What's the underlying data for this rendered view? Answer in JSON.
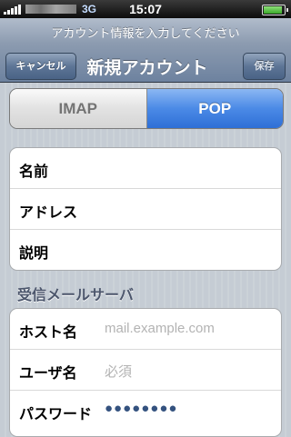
{
  "status_bar": {
    "network": "3G",
    "time": "15:07"
  },
  "navbar": {
    "prompt": "アカウント情報を入力してください",
    "cancel_label": "キャンセル",
    "title": "新規アカウント",
    "save_label": "保存"
  },
  "account_type": {
    "options": [
      "IMAP",
      "POP"
    ],
    "selected": "POP"
  },
  "account_fields": [
    {
      "label": "名前",
      "value": ""
    },
    {
      "label": "アドレス",
      "value": ""
    },
    {
      "label": "説明",
      "value": ""
    }
  ],
  "incoming_server": {
    "header": "受信メールサーバ",
    "host": {
      "label": "ホスト名",
      "placeholder": "mail.example.com"
    },
    "username": {
      "label": "ユーザ名",
      "placeholder": "必須"
    },
    "password": {
      "label": "パスワード",
      "value": "●●●●●●●●"
    }
  }
}
